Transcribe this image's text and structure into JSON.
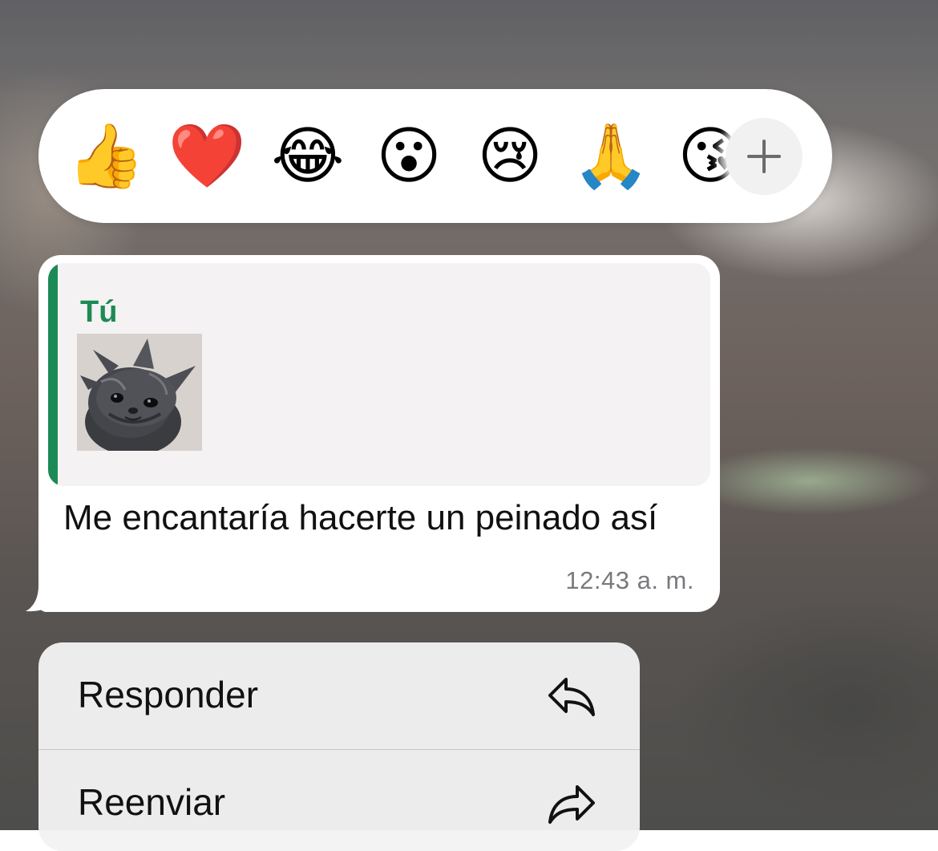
{
  "reactions": {
    "emojis": [
      {
        "name": "thumbs-up",
        "glyph": "👍"
      },
      {
        "name": "red-heart",
        "glyph": "❤️"
      },
      {
        "name": "tears-of-joy",
        "glyph": "😂"
      },
      {
        "name": "astonished",
        "glyph": "😮"
      },
      {
        "name": "crying",
        "glyph": "😢"
      },
      {
        "name": "folded-hands",
        "glyph": "🙏"
      },
      {
        "name": "face-blowing-kiss",
        "glyph": "😘"
      }
    ],
    "more_icon": "plus-icon"
  },
  "message": {
    "quote_author": "Tú",
    "quote_image": "kitten-photo",
    "text": "Me encantaría hacerte un peinado así",
    "time": "12:43 a. m."
  },
  "menu": {
    "items": [
      {
        "label": "Responder",
        "icon": "reply-arrow-icon"
      },
      {
        "label": "Reenviar",
        "icon": "forward-arrow-icon"
      }
    ]
  },
  "colors": {
    "accent_green": "#1c8a55",
    "bubble": "#ffffff",
    "quote_bg": "#f4f2f3",
    "timestamp": "#7a7a7e"
  }
}
